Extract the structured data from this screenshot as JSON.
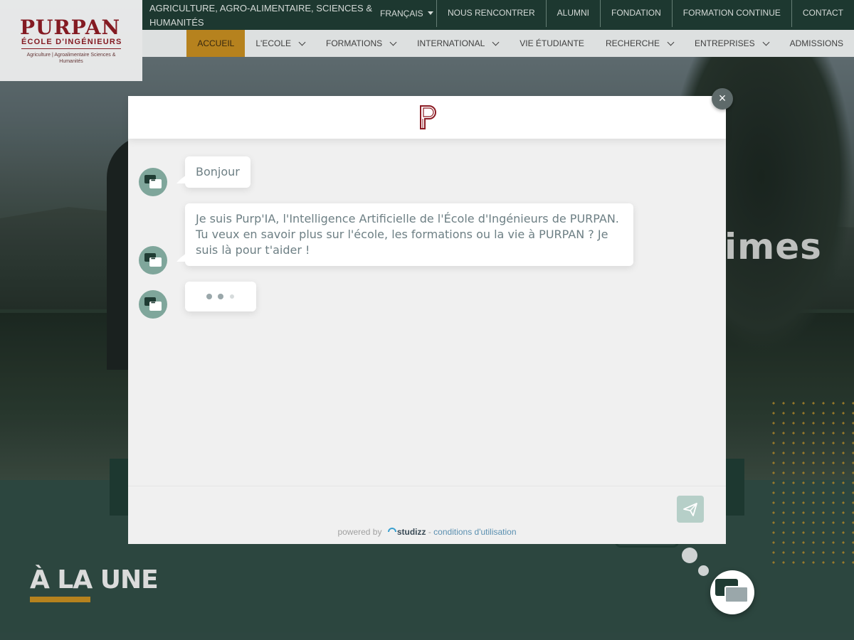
{
  "header": {
    "logo": {
      "name": "PURPAN",
      "subtitle": "ÉCOLE D'INGÉNIEURS",
      "tagline": "Agriculture | Agroalimentaire Sciences & Humanités"
    },
    "tagline": "AGRICULTURE, AGRO-ALIMENTAIRE, SCIENCES & HUMANITÉS",
    "language": "FRANÇAIS",
    "top_links": [
      "NOUS RENCONTRER",
      "ALUMNI",
      "FONDATION",
      "FORMATION CONTINUE",
      "CONTACT"
    ],
    "nav": [
      {
        "label": "ACCUEIL",
        "active": true,
        "dropdown": false
      },
      {
        "label": "L'ECOLE",
        "active": false,
        "dropdown": true
      },
      {
        "label": "FORMATIONS",
        "active": false,
        "dropdown": true
      },
      {
        "label": "INTERNATIONAL",
        "active": false,
        "dropdown": true
      },
      {
        "label": "VIE ÉTUDIANTE",
        "active": false,
        "dropdown": false
      },
      {
        "label": "RECHERCHE",
        "active": false,
        "dropdown": true
      },
      {
        "label": "ENTREPRISES",
        "active": false,
        "dropdown": true
      },
      {
        "label": "ADMISSIONS",
        "active": false,
        "dropdown": false
      }
    ]
  },
  "hero": {
    "partial_word": "imes"
  },
  "section": {
    "title": "À LA UNE"
  },
  "chat": {
    "close_label": "×",
    "messages": [
      "Bonjour",
      "Je suis Purp'IA, l'Intelligence Artificielle de l'École d'Ingénieurs de PURPAN. Tu veux en savoir plus sur l'école, les formations ou la vie à PURPAN ? Je suis là pour t'aider !"
    ],
    "typing": true,
    "input_placeholder": "",
    "powered_by": "powered by",
    "brand": "studizz",
    "separator": " - ",
    "conditions": "conditions d'utilisation"
  },
  "colors": {
    "primary_green": "#1f3b33",
    "accent_gold": "#c08a20",
    "brand_red": "#8c1c24",
    "avatar_green": "#7fa69b"
  }
}
